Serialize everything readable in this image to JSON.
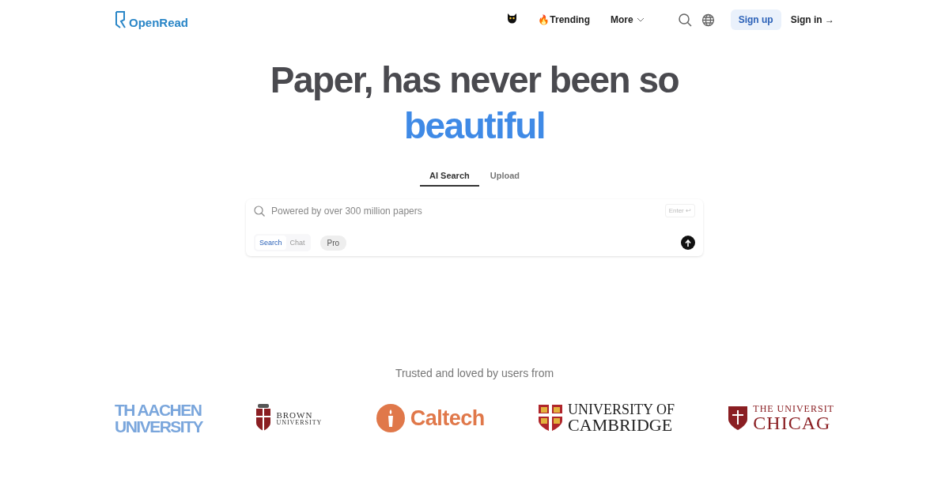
{
  "header": {
    "brand": "OpenRead",
    "nav": [
      {
        "kind": "icon"
      },
      {
        "kind": "text",
        "label": "🔥Trending"
      },
      {
        "kind": "menu",
        "label": "More"
      }
    ],
    "sign_up": "Sign up",
    "sign_in": "Sign in →"
  },
  "hero": {
    "title": "Paper, has never been so",
    "highlight": "beautiful"
  },
  "tabs": [
    {
      "label": "AI Search",
      "selected": true
    },
    {
      "label": "Upload",
      "selected": false
    }
  ],
  "search": {
    "placeholder": "Powered by over 300 million papers",
    "enter_hint": "Enter ↩",
    "modes": [
      {
        "label": "Search",
        "selected": true
      },
      {
        "label": "Chat",
        "selected": false
      }
    ],
    "pro": "Pro"
  },
  "trusted": {
    "caption": "Trusted and loved by users from",
    "logos": [
      {
        "kind": "aachen",
        "lines": [
          "TH AACHEN",
          "UNIVERSITY"
        ]
      },
      {
        "kind": "brown",
        "lines": [
          "BROWN",
          "UNIVERSITY"
        ]
      },
      {
        "kind": "caltech",
        "lines": [
          "Caltech"
        ]
      },
      {
        "kind": "cambridge",
        "lines": [
          "UNIVERSITY OF",
          "CAMBRIDGE"
        ]
      },
      {
        "kind": "chicago",
        "lines": [
          "THE UNIVERSIT",
          "CHICAG"
        ]
      }
    ]
  }
}
